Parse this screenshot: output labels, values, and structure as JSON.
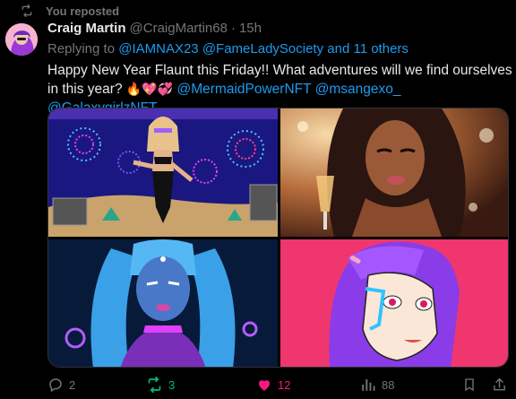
{
  "repost_banner": {
    "label": "You reposted",
    "icon": "repost-icon"
  },
  "tweet": {
    "display_name": "Craig Martin",
    "handle": "@CraigMartin68",
    "separator": "·",
    "time": "15h",
    "replying_prefix": "Replying to",
    "replying_to_1": "@IAMNAX23",
    "replying_to_2": "@FameLadySociety",
    "replying_others": "and 11 others",
    "text_line1": "Happy New Year Flaunt this Friday!! What adventures will we find ourselves",
    "text_line2": "in this year?",
    "emojis": "🔥💖💞",
    "mention_1": "@MermaidPowerNFT",
    "mention_2": "@msangexo_",
    "mention_3": "@GalaxygirlzNFT"
  },
  "media": [
    {
      "name": "fireworks-mermaid-image"
    },
    {
      "name": "champagne-woman-image"
    },
    {
      "name": "blue-alien-woman-image"
    },
    {
      "name": "purple-hair-cyborg-image"
    }
  ],
  "actions": {
    "reply_count": "2",
    "repost_count": "3",
    "like_count": "12",
    "views_count": "88"
  },
  "colors": {
    "background": "#000000",
    "text": "#e7e9ea",
    "secondary": "#71767b",
    "link": "#1d9bf0",
    "repost_green": "#00ba7c",
    "like_pink": "#f91880"
  }
}
